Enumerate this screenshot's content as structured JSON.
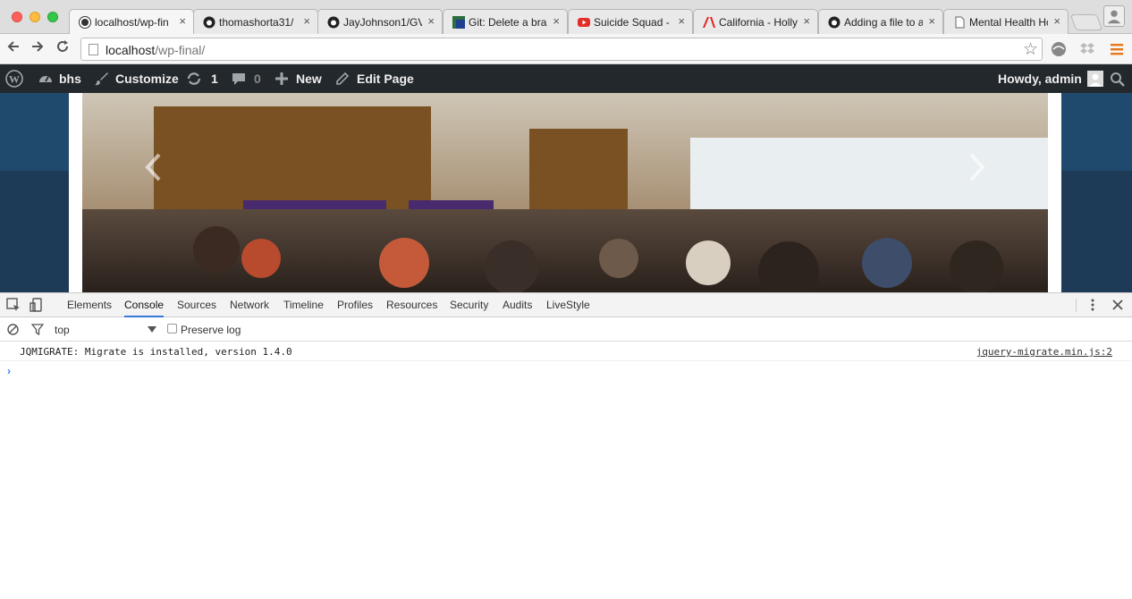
{
  "browser": {
    "tabs": [
      {
        "title": "localhost/wp-fin",
        "icon": "wordpress-icon",
        "active": true
      },
      {
        "title": "thomashorta31/",
        "icon": "github-icon",
        "active": false
      },
      {
        "title": "JayJohnson1/GV",
        "icon": "github-icon",
        "active": false
      },
      {
        "title": "Git: Delete a bra",
        "icon": "git-tower-icon",
        "active": false
      },
      {
        "title": "Suicide Squad -",
        "icon": "youtube-icon",
        "active": false
      },
      {
        "title": "California - Holly",
        "icon": "adobe-icon",
        "active": false
      },
      {
        "title": "Adding a file to a",
        "icon": "github-icon",
        "active": false
      },
      {
        "title": "Mental Health Ho",
        "icon": "page-icon",
        "active": false
      }
    ],
    "tab_close_glyph": "×",
    "url_host": "localhost",
    "url_path": "/wp-final/"
  },
  "admin_bar": {
    "site_name": "bhs",
    "customize": "Customize",
    "updates_count": "1",
    "comments_count": "0",
    "new_label": "New",
    "edit_label": "Edit Page",
    "howdy": "Howdy, admin"
  },
  "devtools": {
    "tabs": [
      "Elements",
      "Console",
      "Sources",
      "Network",
      "Timeline",
      "Profiles",
      "Resources",
      "Security",
      "Audits",
      "LiveStyle"
    ],
    "active_tab": "Console",
    "context": "top",
    "preserve_log": "Preserve log",
    "messages": [
      {
        "text": "JQMIGRATE: Migrate is installed, version 1.4.0",
        "source": "jquery-migrate.min.js:2"
      }
    ],
    "prompt": "›"
  },
  "colors": {
    "adminbar": "#23282d",
    "page_bg": "#1d3b57",
    "devtools_accent": "#3879d9"
  }
}
